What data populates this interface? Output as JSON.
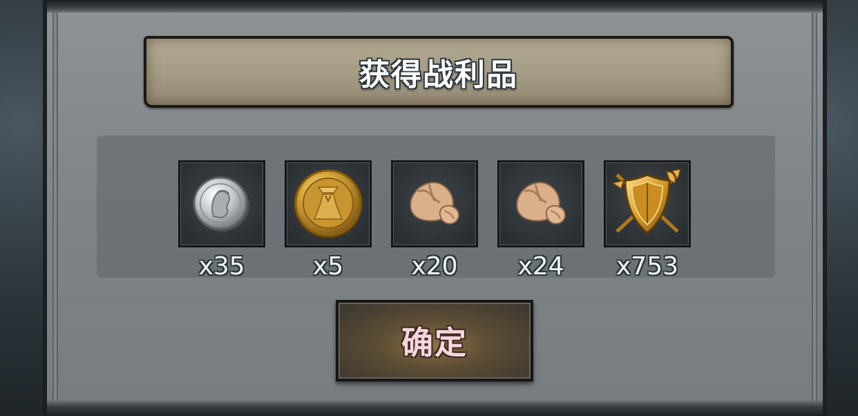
{
  "dialog": {
    "title": "获得战利品"
  },
  "rewards": [
    {
      "icon": "silver-coin-icon",
      "count": "x35"
    },
    {
      "icon": "gold-coin-icon",
      "count": "x5"
    },
    {
      "icon": "stone-ore-icon",
      "count": "x20"
    },
    {
      "icon": "stone-ore-icon",
      "count": "x24"
    },
    {
      "icon": "golden-shield-emblem-icon",
      "count": "x753"
    }
  ],
  "confirm": {
    "label": "确定"
  },
  "colors": {
    "banner": "#a59c85",
    "panel": "#7f8588",
    "button_glow": "#8a7144",
    "button_text": "#f7d5dc"
  }
}
